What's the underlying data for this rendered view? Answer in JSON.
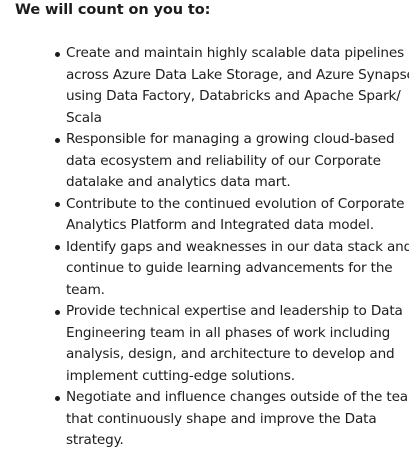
{
  "heading": "We will count on you to:",
  "duties": [
    {
      "lines": [
        "Create and maintain highly scalable data pipelines",
        "across Azure Data Lake Storage, and Azure Synapse",
        "using Data Factory, Databricks and Apache Spark/",
        "Scala"
      ]
    },
    {
      "lines": [
        "Responsible for managing a growing cloud-based",
        "data ecosystem and reliability of our Corporate",
        "datalake and analytics data mart."
      ]
    },
    {
      "lines": [
        "Contribute to the continued evolution of Corporate",
        "Analytics Platform and Integrated data model."
      ]
    },
    {
      "lines": [
        "Identify gaps and weaknesses in our data stack and",
        "continue to guide learning advancements for the",
        "team."
      ]
    },
    {
      "lines": [
        "Provide technical expertise and leadership to Data",
        "Engineering team in all phases of work including",
        "analysis, design, and architecture to develop and",
        "implement cutting-edge solutions."
      ]
    },
    {
      "lines": [
        "Negotiate and influence changes outside of the team",
        "that continuously shape and improve the Data",
        "strategy."
      ]
    }
  ]
}
